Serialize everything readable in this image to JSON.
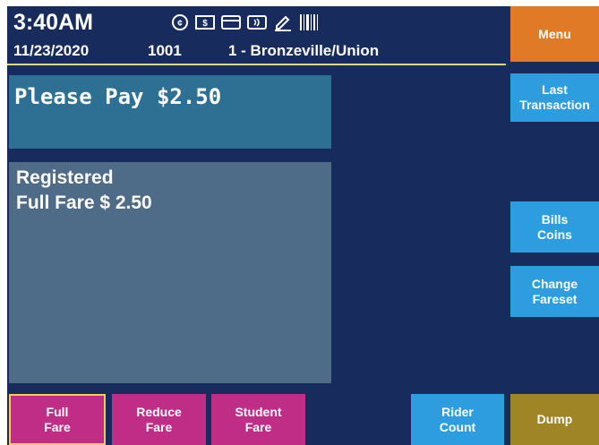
{
  "header": {
    "time": "3:40AM",
    "date": "11/23/2020",
    "terminal_id": "1001",
    "route": "1 - Bronzeville/Union",
    "status_icons": [
      "coin-icon",
      "cash-icon",
      "card-icon",
      "contactless-icon",
      "pencil-icon",
      "barcode-icon"
    ]
  },
  "main": {
    "prompt": "Please Pay $2.50",
    "status_line1": "Registered",
    "status_line2": "Full Fare $ 2.50"
  },
  "side_buttons": {
    "menu": "Menu",
    "last_transaction": "Last\nTransaction",
    "bills_coins": "Bills\nCoins",
    "change_fareset": "Change\nFareset"
  },
  "bottom_buttons": {
    "full_fare": "Full\nFare",
    "reduce_fare": "Reduce\nFare",
    "student_fare": "Student\nFare",
    "rider_count": "Rider\nCount",
    "dump": "Dump"
  },
  "colors": {
    "background": "#172c5c",
    "orange": "#e07a27",
    "blue": "#2d9de0",
    "magenta": "#c02d86",
    "olive": "#a08527",
    "prompt_panel": "#2e6f94",
    "status_panel": "#4e6b87"
  }
}
